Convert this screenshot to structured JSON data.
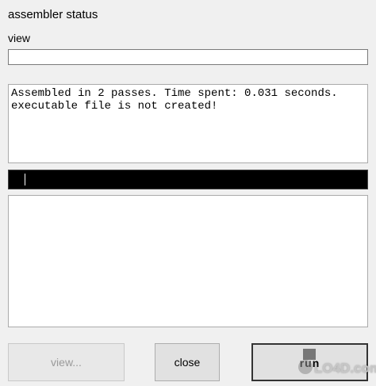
{
  "window": {
    "title": "assembler status"
  },
  "view_section": {
    "label": "view",
    "value": ""
  },
  "status": {
    "lines": "Assembled in 2 passes. Time spent: 0.031 seconds.\nexecutable file is not created!"
  },
  "console": {
    "value": ""
  },
  "output": {
    "value": ""
  },
  "buttons": {
    "view_label": "view...",
    "close_label": "close",
    "run_label": "run"
  },
  "watermark": {
    "text": "LO4D.com"
  }
}
